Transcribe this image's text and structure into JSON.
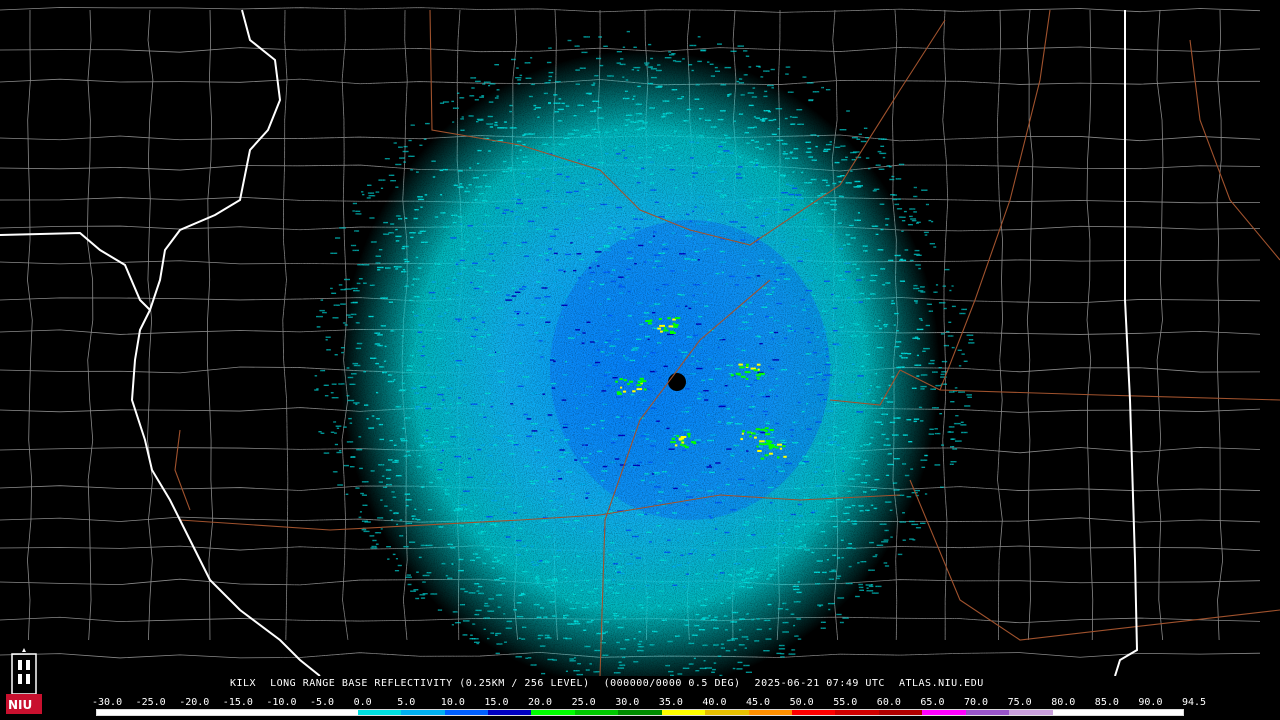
{
  "product": {
    "station": "KILX",
    "name": "LONG RANGE BASE REFLECTIVITY (0.25KM / 256 LEVEL)",
    "scan": "(000000/0000 0.5 DEG)",
    "timestamp": "2025-06-21 07:49 UTC",
    "source": "ATLAS.NIU.EDU"
  },
  "logo": {
    "text": "NIU",
    "icon": "university-tower-logo-icon",
    "color": "#c8102e"
  },
  "legend": {
    "labels": [
      "-30.0",
      "-25.0",
      "-20.0",
      "-15.0",
      "-10.0",
      "-5.0",
      "0.0",
      "5.0",
      "10.0",
      "15.0",
      "20.0",
      "25.0",
      "30.0",
      "35.0",
      "40.0",
      "45.0",
      "50.0",
      "55.0",
      "60.0",
      "65.0",
      "70.0",
      "75.0",
      "80.0",
      "85.0",
      "90.0",
      "94.5"
    ],
    "colors": [
      "#ffffff",
      "#ffffff",
      "#ffffff",
      "#ffffff",
      "#ffffff",
      "#ffffff",
      "#00e0e0",
      "#00b0f0",
      "#0060ff",
      "#0000c0",
      "#00ff00",
      "#00c800",
      "#008c00",
      "#ffff00",
      "#e6c000",
      "#ff9000",
      "#ff0000",
      "#d00000",
      "#b00000",
      "#ff00ff",
      "#9955c9",
      "#c9a0dc",
      "#ffffff",
      "#ffffff",
      "#ffffff"
    ]
  },
  "map": {
    "state_border_color": "#ffffff",
    "county_line_color": "#8a8a8a",
    "road_color": "#a0522d",
    "echo_colors": [
      "#00e0e0",
      "#00b0f0",
      "#0060ff",
      "#0000c0",
      "#00ff00",
      "#ffff00"
    ]
  }
}
